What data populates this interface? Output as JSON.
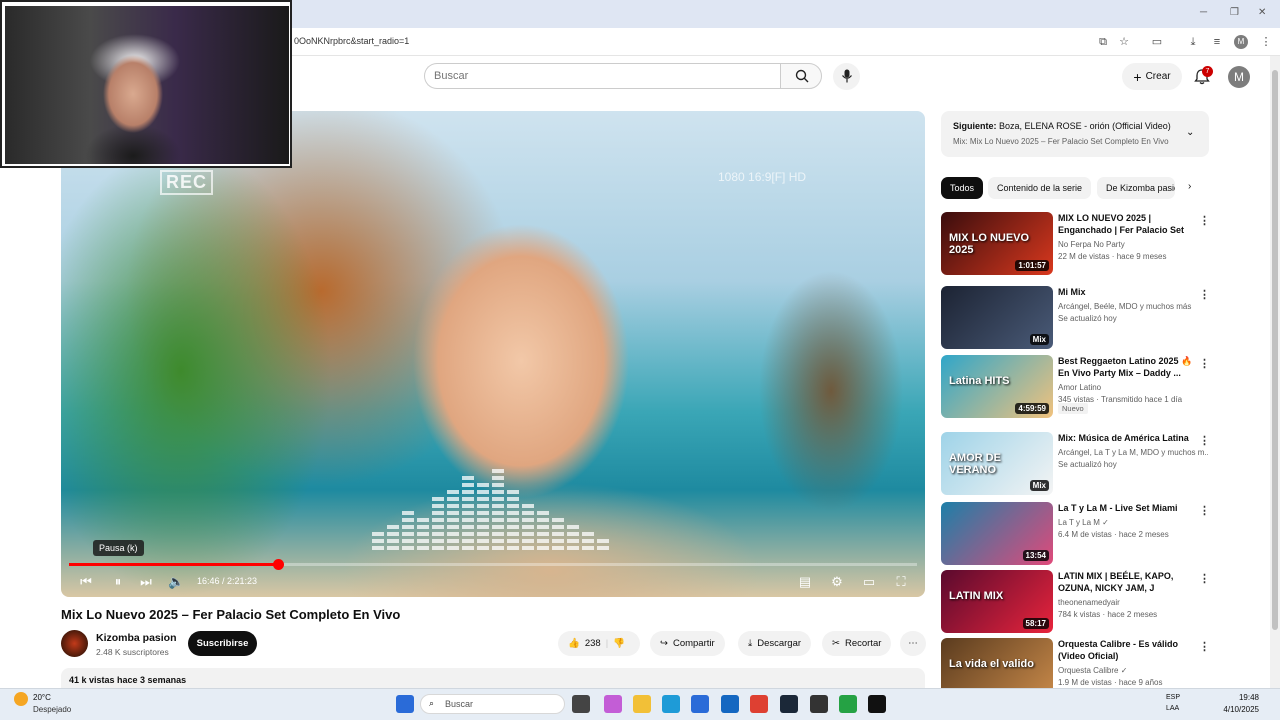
{
  "browser": {
    "url": "0OoNKNrpbrc&start_radio=1",
    "profile_initial": "M"
  },
  "header": {
    "search_placeholder": "Buscar",
    "create_label": "Crear",
    "notifications_count": "7",
    "avatar_initial": "M"
  },
  "player": {
    "rec_label": "REC",
    "hd_label": "1080  16:9[F]  HD",
    "tooltip": "Pausa (k)",
    "time": "16:46 / 2:21:23",
    "progress": 0.246
  },
  "video": {
    "title": "Mix Lo Nuevo 2025 – Fer Palacio Set Completo En Vivo",
    "channel": "Kizomba pasion",
    "subscribers": "2.48 K suscriptores",
    "subscribe_label": "Suscribirse",
    "likes": "238",
    "share_label": "Compartir",
    "download_label": "Descargar",
    "clip_label": "Recortar",
    "description": "41 k vistas  hace 3 semanas"
  },
  "upnext": {
    "prefix": "Siguiente:",
    "title": "Boza, ELENA ROSE - orión (Official Video)",
    "playlist": "Mix: Mix Lo Nuevo 2025 – Fer Palacio Set Completo En Vivo"
  },
  "chips": [
    "Todos",
    "Contenido de la serie",
    "De Kizomba pasión"
  ],
  "recommendations": [
    {
      "title": "MIX LO NUEVO 2025 | Enganchado | Fer Palacio Set ...",
      "channel": "No Ferpa No Party",
      "meta": "22 M de vistas · hace 9 meses",
      "duration": "1:01:57",
      "badge": "",
      "thumb_color_a": "#3a0d0d",
      "thumb_color_b": "#d9381e",
      "thumb_text": "MIX LO NUEVO 2025"
    },
    {
      "title": "Mi Mix",
      "channel": "Arcángel, Beéle, MDO y muchos más",
      "meta": "Se actualizó hoy",
      "duration": "Mix",
      "badge": "",
      "thumb_color_a": "#1c2333",
      "thumb_color_b": "#4a5b78",
      "thumb_text": ""
    },
    {
      "title": "Best Reggaeton Latino 2025 🔥 En Vivo Party Mix – Daddy ...",
      "channel": "Amor Latino",
      "meta": "345 vistas · Transmitido hace 1 día",
      "duration": "4:59:59",
      "badge": "Nuevo",
      "thumb_color_a": "#2fa6c9",
      "thumb_color_b": "#f1c27d",
      "thumb_text": "Latina HITS"
    },
    {
      "title": "Mix: Música de América Latina",
      "channel": "Arcángel, La T y La M, MDO y muchos m...",
      "meta": "Se actualizó hoy",
      "duration": "Mix",
      "badge": "",
      "thumb_color_a": "#9ed3e8",
      "thumb_color_b": "#f4f4f4",
      "thumb_text": "AMOR DE VERANO"
    },
    {
      "title": "La T y La M - Live Set Miami",
      "channel": "La T y La M ✓",
      "meta": "6.4 M de vistas · hace 2 meses",
      "duration": "13:54",
      "badge": "",
      "thumb_color_a": "#1d7fa8",
      "thumb_color_b": "#e04a7a",
      "thumb_text": ""
    },
    {
      "title": "LATIN MIX | BEÉLE, KAPO, OZUNA, NICKY JAM, J BALVIN...",
      "channel": "theonenamedyair",
      "meta": "784 k vistas · hace 2 meses",
      "duration": "58:17",
      "badge": "",
      "thumb_color_a": "#5a0a2e",
      "thumb_color_b": "#e8243c",
      "thumb_text": "LATIN MIX"
    },
    {
      "title": "Orquesta Calibre - Es válido (Video Oficial)",
      "channel": "Orquesta Calibre ✓",
      "meta": "1.9 M de vistas · hace 9 años",
      "duration": "",
      "badge": "",
      "thumb_color_a": "#5a3b1e",
      "thumb_color_b": "#c98a4a",
      "thumb_text": "La vida el valido"
    }
  ],
  "taskbar": {
    "weather_temp": "20°C",
    "weather_desc": "Despejado",
    "search_label": "Buscar",
    "lang_top": "ESP",
    "lang_bottom": "LAA",
    "time": "19:48",
    "date": "4/10/2025",
    "apps": [
      {
        "name": "windows-start",
        "color": "#2a6bd8"
      },
      {
        "name": "task-view",
        "color": "#444444"
      },
      {
        "name": "copilot",
        "color": "#c35dd6"
      },
      {
        "name": "file-explorer",
        "color": "#f2c037"
      },
      {
        "name": "edge",
        "color": "#1e9bd7"
      },
      {
        "name": "store",
        "color": "#2a6bd8"
      },
      {
        "name": "outlook",
        "color": "#1467c1"
      },
      {
        "name": "chrome",
        "color": "#de4032"
      },
      {
        "name": "steam",
        "color": "#1b2838"
      },
      {
        "name": "app-red-dot",
        "color": "#333333"
      },
      {
        "name": "whatsapp-green",
        "color": "#25a244"
      },
      {
        "name": "tiktok",
        "color": "#111111"
      }
    ]
  }
}
